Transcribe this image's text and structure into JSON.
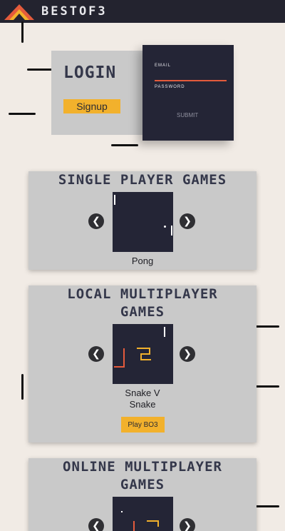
{
  "header": {
    "brand": "BESTOF3",
    "logo_colors": [
      "#e45b3c",
      "#f2b12c",
      "#c9c9c9"
    ]
  },
  "login": {
    "title": "LOGIN",
    "signup_label": "Signup",
    "email_label": "EMAIL",
    "password_label": "PASSWORD",
    "submit_label": "SUBMIT"
  },
  "sections": {
    "single": {
      "title": "SINGLE PLAYER GAMES",
      "game": "Pong"
    },
    "local": {
      "title_line1": "LOCAL MULTIPLAYER",
      "title_line2": "GAMES",
      "game_line1": "Snake V",
      "game_line2": "Snake",
      "play_label": "Play BO3"
    },
    "online": {
      "title_line1": "ONLINE MULTIPLAYER",
      "title_line2": "GAMES"
    }
  },
  "colors": {
    "accent_yellow": "#f2b12c",
    "accent_red": "#e45b3c",
    "navy": "#242536",
    "panel": "#c9c9c9",
    "background": "#f1ebe5"
  },
  "icons": {
    "prev": "arrow-left-icon",
    "next": "arrow-right-icon"
  }
}
